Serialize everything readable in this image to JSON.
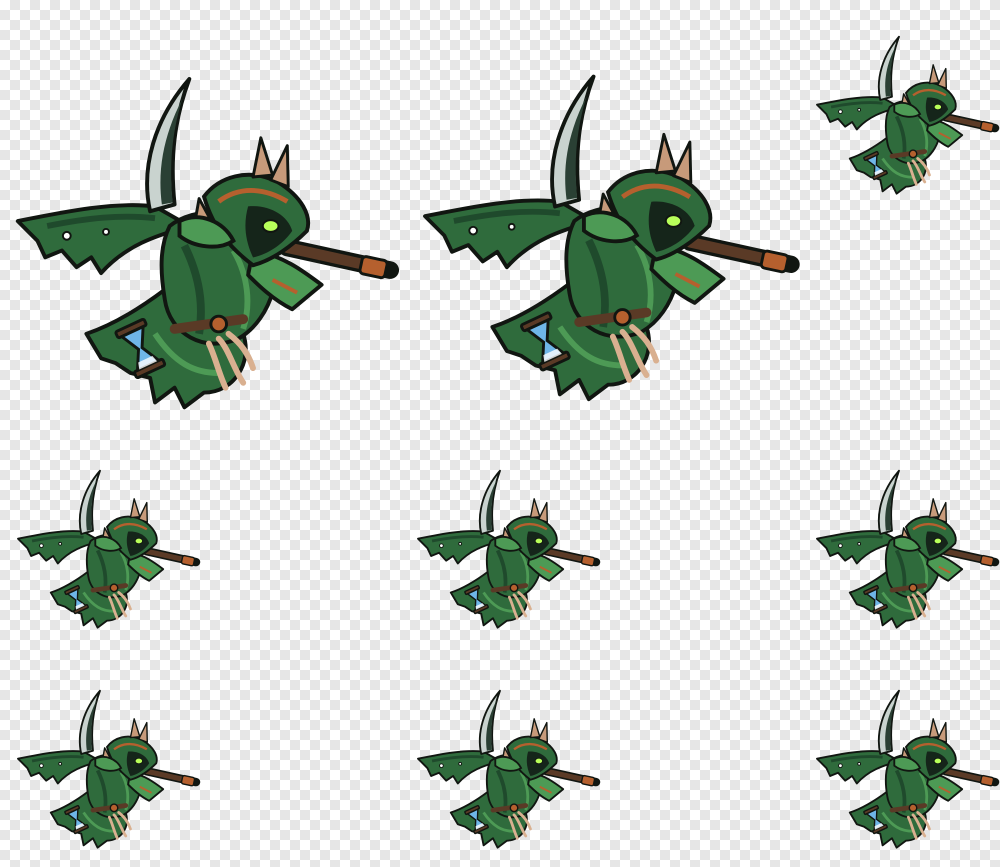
{
  "sheet": {
    "type": "sprite-sheet",
    "background": "transparent-checkerboard",
    "character": "hooded-scythe-reaper",
    "frame_count": 9,
    "palette": {
      "cloak_dark": "#1f4a2c",
      "cloak_mid": "#2f6b3c",
      "cloak_light": "#4d9a55",
      "outline": "#111611",
      "blade": "#c9d3cf",
      "blade_dark": "#2a4034",
      "spike": "#c79a7a",
      "staff": "#5a3a26",
      "staff_cap": "#b5602e",
      "glass": "#6fb6e8",
      "eye_glow": "#b8ff5a",
      "claw": "#d9b090"
    }
  }
}
